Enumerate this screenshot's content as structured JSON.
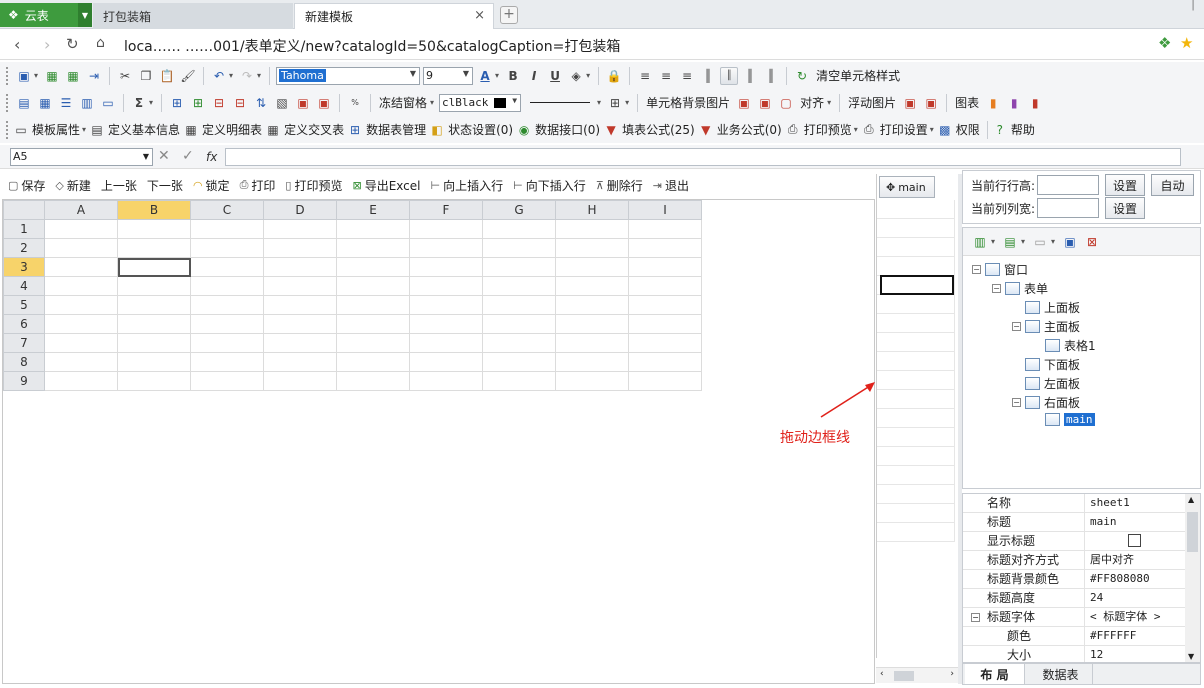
{
  "browser": {
    "brand": "云表",
    "tabs": [
      {
        "label": "打包装箱"
      },
      {
        "label": "新建模板"
      }
    ],
    "url": "loca…… ……001/表单定义/new?catalogId=50&catalogCaption=打包装箱"
  },
  "toolbar1": {
    "font_name": "Tahoma",
    "font_size": "9",
    "clear_style": "清空单元格样式"
  },
  "toolbar2": {
    "freeze": "冻结窗格",
    "color": "clBlack",
    "cell_bg": "单元格背景图片",
    "align": "对齐",
    "float_img": "浮动图片",
    "chart": "图表"
  },
  "toolbar3": {
    "items": [
      "模板属性",
      "定义基本信息",
      "定义明细表",
      "定义交叉表",
      "数据表管理",
      "状态设置(0)",
      "数据接口(0)",
      "填表公式(25)",
      "业务公式(0)",
      "打印预览",
      "打印设置",
      "权限",
      "帮助"
    ]
  },
  "formula": {
    "cell_ref": "A5"
  },
  "actions": [
    "保存",
    "新建",
    "上一张",
    "下一张",
    "锁定",
    "打印",
    "打印预览",
    "导出Excel",
    "向上插入行",
    "向下插入行",
    "删除行",
    "退出"
  ],
  "sheet": {
    "columns": [
      "A",
      "B",
      "C",
      "D",
      "E",
      "F",
      "G",
      "H",
      "I"
    ],
    "rows": [
      "1",
      "2",
      "3",
      "4",
      "5",
      "6",
      "7",
      "8",
      "9"
    ],
    "active_col": "B",
    "active_row": "3"
  },
  "right_tab": "main",
  "annotation": "拖动边框线",
  "size_panel": {
    "row_height_label": "当前行行高:",
    "col_width_label": "当前列列宽:",
    "set": "设置",
    "auto": "自动"
  },
  "tree": {
    "nodes": [
      "窗口",
      "表单",
      "上面板",
      "主面板",
      "表格1",
      "下面板",
      "左面板",
      "右面板",
      "main"
    ]
  },
  "properties": [
    {
      "k": "名称",
      "v": "sheet1"
    },
    {
      "k": "标题",
      "v": "main"
    },
    {
      "k": "显示标题",
      "v": ""
    },
    {
      "k": "标题对齐方式",
      "v": "居中对齐"
    },
    {
      "k": "标题背景颜色",
      "v": "#FF808080"
    },
    {
      "k": "标题高度",
      "v": "24"
    },
    {
      "k": "标题字体",
      "v": "< 标题字体 >"
    },
    {
      "k": "颜色",
      "v": "#FFFFFF"
    },
    {
      "k": "大小",
      "v": "12"
    }
  ],
  "bottom_tabs": [
    "布 局",
    "数据表"
  ]
}
